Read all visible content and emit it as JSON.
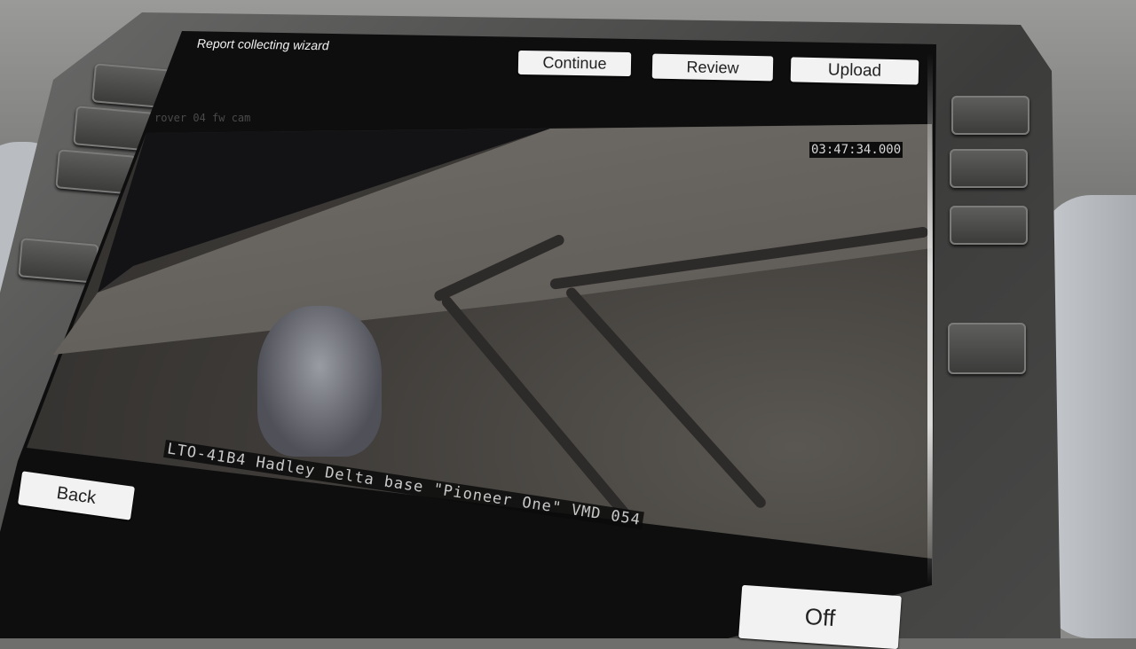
{
  "wizard": {
    "title": "Report collecting wizard"
  },
  "toolbar": {
    "continue_label": "Continue",
    "review_label": "Review",
    "upload_label": "Upload"
  },
  "feed": {
    "camera_label": "rover 04 fw cam",
    "timestamp": "03:47:34.000",
    "caption": "LTO-41B4 Hadley Delta base \"Pioneer One\" VMD 054"
  },
  "footer": {
    "back_label": "Back",
    "off_label": "Off"
  }
}
